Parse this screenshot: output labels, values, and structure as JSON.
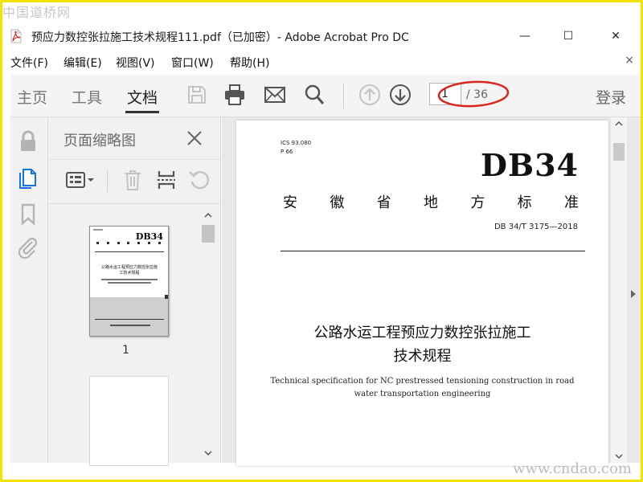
{
  "watermarks": {
    "top": "中国道桥网",
    "bottom": "www.cndao.com"
  },
  "window": {
    "title": "预应力数控张拉施工技术规程111.pdf（已加密）- Adobe Acrobat Pro DC",
    "minimize": "—",
    "maximize": "☐",
    "close": "✕"
  },
  "menu": {
    "items": [
      "文件(F)",
      "编辑(E)",
      "视图(V)",
      "窗口(W)",
      "帮助(H)"
    ],
    "close": "×"
  },
  "toolbar": {
    "tabs": [
      "主页",
      "工具",
      "文档"
    ],
    "active_tab": "文档",
    "page_current": "1",
    "page_total": "/ 36",
    "login": "登录",
    "icons": [
      "save-icon",
      "print-icon",
      "mail-icon",
      "search-icon",
      "page-up-icon",
      "page-down-icon"
    ],
    "annotation_color": "#d9251c"
  },
  "leftnav": {
    "icons": [
      "lock-icon",
      "page-thumbnails-icon",
      "bookmark-icon",
      "attachment-icon"
    ],
    "accent": "#1473e6"
  },
  "thumbnails_panel": {
    "title": "页面缩略图",
    "page_label": "1",
    "thumb": {
      "db": "DB34",
      "title": "公路水运工程预应力数控张拉施工技术规程"
    }
  },
  "document": {
    "ics": "ICS 93.080",
    "p": "P 66",
    "db": "DB34",
    "standard_chars": [
      "安",
      "徽",
      "省",
      "地",
      "方",
      "标",
      "准"
    ],
    "code": "DB 34/T  3175—2018",
    "title_line1": "公路水运工程预应力数控张拉施工",
    "title_line2": "技术规程",
    "english_title": "Technical specification for NC prestressed tensioning construction in road water transportation engineering"
  }
}
